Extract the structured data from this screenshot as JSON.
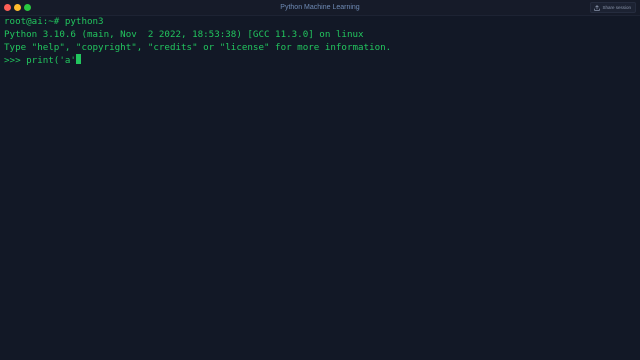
{
  "window": {
    "title": "Python Machine Learning"
  },
  "share_button": {
    "label": "Share session"
  },
  "terminal": {
    "lines": [
      "root@ai:~# python3",
      "Python 3.10.6 (main, Nov  2 2022, 18:53:38) [GCC 11.3.0] on linux",
      "Type \"help\", \"copyright\", \"credits\" or \"license\" for more information."
    ],
    "prompt_input": ">>> print('a'"
  },
  "colors": {
    "background": "#121826",
    "terminal_text": "#22c55e",
    "title_text": "#6f8bb5",
    "close": "#fd5f57",
    "minimize": "#febc2e",
    "maximize": "#28c840"
  }
}
